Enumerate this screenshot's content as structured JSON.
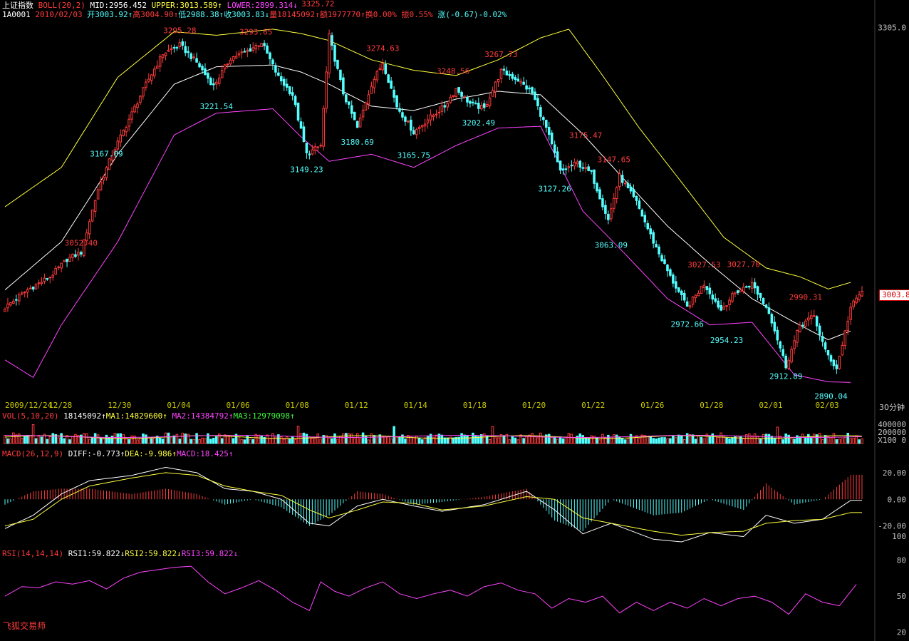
{
  "header": {
    "name": "上证指数",
    "indicator": "BOLL(20,2)",
    "mid": "MID:2956.452",
    "upper": "UPPER:3013.589↑",
    "lower": "LOWER:2899.314↓",
    "code": "1A0001",
    "date": "2010/02/03",
    "open": "开3003.92↑",
    "high": "高3004.90↑",
    "low": "低2988.38↑",
    "close": "收3003.83↓",
    "volume": "量18145092↑",
    "amount": "额1977770↑",
    "turnover": "换0.00%",
    "amplitude": "振0.55%",
    "change": "涨(-0.67)-0.02%"
  },
  "vol_header": {
    "label": "VOL(5,10,20)",
    "value": "18145092↑",
    "ma1": "MA1:14829600↑",
    "ma2": "MA2:14384792↑",
    "ma3": "MA3:12979098↑"
  },
  "macd_header": {
    "label": "MACD(26,12,9)",
    "diff": "DIFF:-0.773↑",
    "dea": "DEA:-9.986↑",
    "macd": "MACD:18.425↑"
  },
  "rsi_header": {
    "label": "RSI(14,14,14)",
    "rsi1": "RSI1:59.822↓",
    "rsi2": "RSI2:59.822↓",
    "rsi3": "RSI3:59.822↓"
  },
  "current_price": "3003.8",
  "interval": "30分钟",
  "watermark": "飞狐交易师",
  "colors": {
    "up": "#ff3b3b",
    "down": "#54ffff",
    "mid": "#ffffff",
    "upper": "#ffff3f",
    "lower": "#ff44ff",
    "axis": "#c0c0c0",
    "date": "#c8c800"
  },
  "chart_data": [
    {
      "type": "candlestick",
      "title": "上证指数 BOLL(20,2)",
      "yaxis_tick": [
        "3305.0"
      ],
      "yrange": [
        2880,
        3320
      ],
      "x_labels": [
        "2009/12/24",
        "12/28",
        "12/30",
        "01/04",
        "01/06",
        "01/08",
        "01/12",
        "01/14",
        "01/18",
        "01/20",
        "01/22",
        "01/26",
        "01/28",
        "02/01",
        "02/03"
      ],
      "x_label_index": [
        0,
        19,
        40,
        61,
        82,
        103,
        124,
        145,
        166,
        187,
        208,
        229,
        250,
        271,
        291
      ],
      "annotations": [
        {
          "index": 27,
          "value": 3052.4,
          "label": "3052.40",
          "type": "high"
        },
        {
          "index": 36,
          "value": 3167.09,
          "label": "3167.09",
          "type": "low"
        },
        {
          "index": 62,
          "value": 3295.28,
          "label": "3295.28",
          "type": "high"
        },
        {
          "index": 75,
          "value": 3221.54,
          "label": "3221.54",
          "type": "low"
        },
        {
          "index": 89,
          "value": 3293.65,
          "label": "3293.65",
          "type": "high"
        },
        {
          "index": 111,
          "value": 3325.72,
          "label": "3325.72",
          "type": "high"
        },
        {
          "index": 107,
          "value": 3149.23,
          "label": "3149.23",
          "type": "low"
        },
        {
          "index": 125,
          "value": 3180.69,
          "label": "3180.69",
          "type": "low"
        },
        {
          "index": 134,
          "value": 3274.63,
          "label": "3274.63",
          "type": "high"
        },
        {
          "index": 145,
          "value": 3165.75,
          "label": "3165.75",
          "type": "low"
        },
        {
          "index": 159,
          "value": 3248.56,
          "label": "3248.56",
          "type": "high"
        },
        {
          "index": 168,
          "value": 3202.49,
          "label": "3202.49",
          "type": "low"
        },
        {
          "index": 176,
          "value": 3267.73,
          "label": "3267.73",
          "type": "high"
        },
        {
          "index": 206,
          "value": 3175.47,
          "label": "3175.47",
          "type": "high"
        },
        {
          "index": 195,
          "value": 3127.26,
          "label": "3127.26",
          "type": "low"
        },
        {
          "index": 216,
          "value": 3147.65,
          "label": "3147.65",
          "type": "high"
        },
        {
          "index": 215,
          "value": 3063.09,
          "label": "3063.09",
          "type": "low"
        },
        {
          "index": 248,
          "value": 3027.53,
          "label": "3027.53",
          "type": "high"
        },
        {
          "index": 242,
          "value": 2972.66,
          "label": "2972.66",
          "type": "low"
        },
        {
          "index": 256,
          "value": 2954.23,
          "label": "2954.23",
          "type": "low"
        },
        {
          "index": 262,
          "value": 3027.7,
          "label": "3027.70",
          "type": "high"
        },
        {
          "index": 284,
          "value": 2990.31,
          "label": "2990.31",
          "type": "high"
        },
        {
          "index": 277,
          "value": 2912.89,
          "label": "2912.89",
          "type": "low"
        },
        {
          "index": 293,
          "value": 2890.04,
          "label": "2890.04",
          "type": "low"
        }
      ],
      "close_path": [
        [
          0,
          2985
        ],
        [
          8,
          3005
        ],
        [
          16,
          3020
        ],
        [
          22,
          3040
        ],
        [
          27,
          3048
        ],
        [
          33,
          3120
        ],
        [
          38,
          3160
        ],
        [
          44,
          3200
        ],
        [
          50,
          3240
        ],
        [
          56,
          3275
        ],
        [
          62,
          3285
        ],
        [
          68,
          3265
        ],
        [
          74,
          3238
        ],
        [
          80,
          3270
        ],
        [
          86,
          3278
        ],
        [
          91,
          3288
        ],
        [
          97,
          3248
        ],
        [
          102,
          3228
        ],
        [
          107,
          3160
        ],
        [
          112,
          3170
        ],
        [
          115,
          3295
        ],
        [
          120,
          3230
        ],
        [
          125,
          3190
        ],
        [
          130,
          3240
        ],
        [
          134,
          3265
        ],
        [
          139,
          3215
        ],
        [
          145,
          3185
        ],
        [
          150,
          3200
        ],
        [
          156,
          3215
        ],
        [
          160,
          3235
        ],
        [
          165,
          3218
        ],
        [
          170,
          3212
        ],
        [
          176,
          3255
        ],
        [
          182,
          3245
        ],
        [
          187,
          3230
        ],
        [
          192,
          3190
        ],
        [
          197,
          3140
        ],
        [
          203,
          3150
        ],
        [
          208,
          3138
        ],
        [
          214,
          3085
        ],
        [
          218,
          3135
        ],
        [
          224,
          3105
        ],
        [
          230,
          3060
        ],
        [
          236,
          3020
        ],
        [
          242,
          2985
        ],
        [
          248,
          3012
        ],
        [
          254,
          2982
        ],
        [
          259,
          3002
        ],
        [
          265,
          3012
        ],
        [
          271,
          2980
        ],
        [
          277,
          2918
        ],
        [
          282,
          2965
        ],
        [
          287,
          2975
        ],
        [
          291,
          2935
        ],
        [
          295,
          2915
        ],
        [
          300,
          2985
        ],
        [
          304,
          3003.83
        ]
      ],
      "mid_band": [
        [
          0,
          3005
        ],
        [
          20,
          3060
        ],
        [
          40,
          3160
        ],
        [
          60,
          3240
        ],
        [
          75,
          3260
        ],
        [
          95,
          3262
        ],
        [
          105,
          3254
        ],
        [
          115,
          3240
        ],
        [
          130,
          3215
        ],
        [
          145,
          3210
        ],
        [
          160,
          3223
        ],
        [
          175,
          3232
        ],
        [
          190,
          3228
        ],
        [
          205,
          3183
        ],
        [
          220,
          3130
        ],
        [
          235,
          3078
        ],
        [
          250,
          3035
        ],
        [
          265,
          2995
        ],
        [
          280,
          2968
        ],
        [
          292,
          2948
        ],
        [
          300,
          2958
        ]
      ],
      "upper_band": [
        [
          0,
          3100
        ],
        [
          20,
          3145
        ],
        [
          40,
          3248
        ],
        [
          60,
          3300
        ],
        [
          75,
          3296
        ],
        [
          95,
          3303
        ],
        [
          105,
          3298
        ],
        [
          115,
          3290
        ],
        [
          130,
          3268
        ],
        [
          145,
          3256
        ],
        [
          160,
          3250
        ],
        [
          175,
          3268
        ],
        [
          190,
          3293
        ],
        [
          200,
          3303
        ],
        [
          212,
          3250
        ],
        [
          225,
          3190
        ],
        [
          240,
          3128
        ],
        [
          255,
          3065
        ],
        [
          270,
          3030
        ],
        [
          282,
          3020
        ],
        [
          292,
          3006
        ],
        [
          300,
          3013.589
        ]
      ],
      "lower_band": [
        [
          0,
          2925
        ],
        [
          10,
          2905
        ],
        [
          20,
          2965
        ],
        [
          40,
          3060
        ],
        [
          60,
          3182
        ],
        [
          75,
          3207
        ],
        [
          95,
          3212
        ],
        [
          105,
          3180
        ],
        [
          115,
          3152
        ],
        [
          130,
          3160
        ],
        [
          145,
          3145
        ],
        [
          160,
          3170
        ],
        [
          175,
          3190
        ],
        [
          190,
          3192
        ],
        [
          205,
          3095
        ],
        [
          220,
          3046
        ],
        [
          235,
          2995
        ],
        [
          250,
          2965
        ],
        [
          265,
          2968
        ],
        [
          280,
          2908
        ],
        [
          292,
          2900
        ],
        [
          300,
          2899.314
        ]
      ]
    },
    {
      "type": "bar",
      "title": "VOL(5,10,20)",
      "yaxis_ticks": [
        "400000",
        "200000",
        "X100 0"
      ],
      "ma1": 14829600,
      "ma2": 14384792,
      "ma3": 12979098,
      "last": 18145092
    },
    {
      "type": "bar",
      "title": "MACD(26,12,9)",
      "yaxis_ticks": [
        "20.00",
        "0.00",
        "-20.00"
      ],
      "ylim": [
        -32,
        28
      ],
      "diff_path": [
        [
          0,
          -22
        ],
        [
          10,
          -12
        ],
        [
          20,
          4
        ],
        [
          30,
          14
        ],
        [
          45,
          18
        ],
        [
          57,
          24
        ],
        [
          68,
          20
        ],
        [
          78,
          8
        ],
        [
          88,
          6
        ],
        [
          98,
          0
        ],
        [
          108,
          -18
        ],
        [
          115,
          -20
        ],
        [
          125,
          -5
        ],
        [
          134,
          0
        ],
        [
          145,
          -5
        ],
        [
          155,
          -9
        ],
        [
          170,
          -4
        ],
        [
          185,
          6
        ],
        [
          195,
          -8
        ],
        [
          205,
          -26
        ],
        [
          215,
          -18
        ],
        [
          230,
          -30
        ],
        [
          240,
          -32
        ],
        [
          250,
          -25
        ],
        [
          262,
          -28
        ],
        [
          270,
          -12
        ],
        [
          280,
          -18
        ],
        [
          290,
          -15
        ],
        [
          300,
          -0.773
        ]
      ],
      "dea_path": [
        [
          0,
          -20
        ],
        [
          10,
          -15
        ],
        [
          20,
          0
        ],
        [
          30,
          10
        ],
        [
          45,
          16
        ],
        [
          57,
          20
        ],
        [
          68,
          18
        ],
        [
          78,
          10
        ],
        [
          88,
          6
        ],
        [
          98,
          3
        ],
        [
          108,
          -8
        ],
        [
          115,
          -14
        ],
        [
          125,
          -8
        ],
        [
          134,
          -2
        ],
        [
          145,
          -3
        ],
        [
          155,
          -8
        ],
        [
          170,
          -5
        ],
        [
          185,
          2
        ],
        [
          195,
          0
        ],
        [
          205,
          -14
        ],
        [
          215,
          -18
        ],
        [
          230,
          -24
        ],
        [
          240,
          -27
        ],
        [
          250,
          -25
        ],
        [
          262,
          -24
        ],
        [
          270,
          -18
        ],
        [
          280,
          -16
        ],
        [
          290,
          -15
        ],
        [
          300,
          -9.986
        ]
      ]
    },
    {
      "type": "line",
      "title": "RSI(14,14,14)",
      "yaxis_ticks": [
        "100",
        "80",
        "50",
        "20"
      ],
      "ylim": [
        18,
        100
      ],
      "rsi_path": [
        [
          0,
          50
        ],
        [
          6,
          58
        ],
        [
          12,
          57
        ],
        [
          18,
          62
        ],
        [
          24,
          60
        ],
        [
          30,
          63
        ],
        [
          36,
          56
        ],
        [
          42,
          65
        ],
        [
          48,
          70
        ],
        [
          54,
          72
        ],
        [
          60,
          74
        ],
        [
          66,
          75
        ],
        [
          72,
          62
        ],
        [
          78,
          52
        ],
        [
          84,
          57
        ],
        [
          90,
          63
        ],
        [
          96,
          55
        ],
        [
          102,
          45
        ],
        [
          108,
          38
        ],
        [
          112,
          62
        ],
        [
          117,
          54
        ],
        [
          122,
          50
        ],
        [
          128,
          57
        ],
        [
          134,
          62
        ],
        [
          140,
          52
        ],
        [
          146,
          48
        ],
        [
          152,
          52
        ],
        [
          158,
          55
        ],
        [
          164,
          50
        ],
        [
          170,
          58
        ],
        [
          176,
          61
        ],
        [
          182,
          55
        ],
        [
          188,
          52
        ],
        [
          194,
          40
        ],
        [
          200,
          48
        ],
        [
          206,
          45
        ],
        [
          212,
          50
        ],
        [
          218,
          36
        ],
        [
          224,
          45
        ],
        [
          230,
          38
        ],
        [
          236,
          45
        ],
        [
          242,
          40
        ],
        [
          248,
          48
        ],
        [
          254,
          42
        ],
        [
          260,
          48
        ],
        [
          266,
          50
        ],
        [
          272,
          45
        ],
        [
          278,
          35
        ],
        [
          284,
          52
        ],
        [
          290,
          45
        ],
        [
          296,
          42
        ],
        [
          302,
          59.822
        ]
      ]
    }
  ]
}
